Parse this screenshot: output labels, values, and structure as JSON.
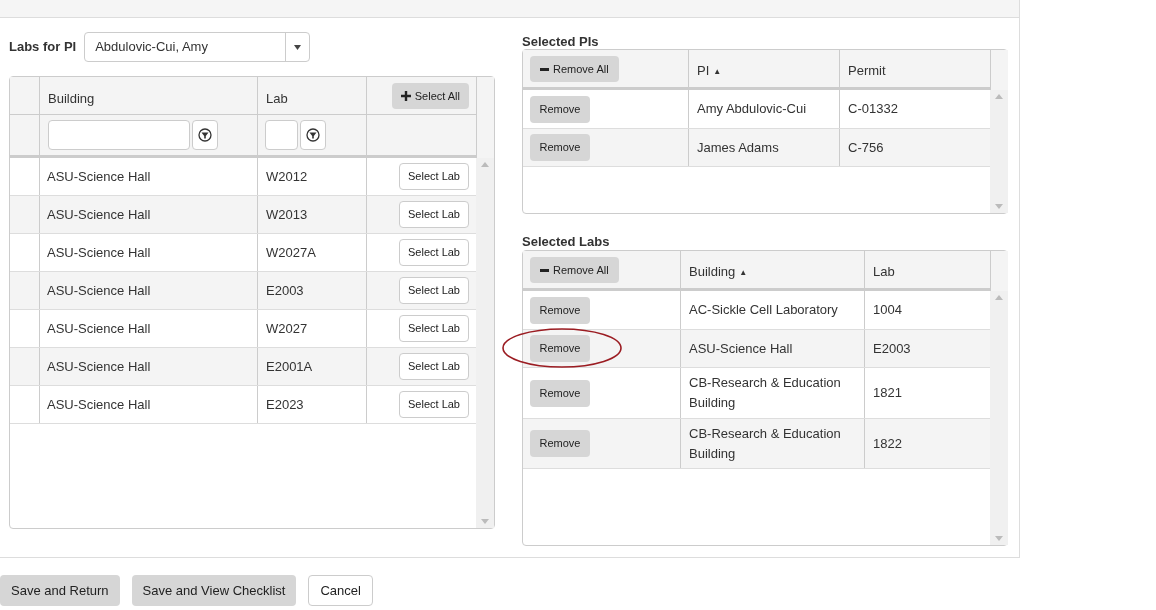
{
  "labs_for_pi": {
    "label": "Labs for PI",
    "value": "Abdulovic-Cui, Amy"
  },
  "labs_grid": {
    "columns": [
      {
        "label": "Building"
      },
      {
        "label": "Lab"
      }
    ],
    "select_all": "Select All",
    "rows": [
      {
        "building": "ASU-Science Hall",
        "lab": "W2012",
        "action": "Select Lab"
      },
      {
        "building": "ASU-Science Hall",
        "lab": "W2013",
        "action": "Select Lab"
      },
      {
        "building": "ASU-Science Hall",
        "lab": "W2027A",
        "action": "Select Lab"
      },
      {
        "building": "ASU-Science Hall",
        "lab": "E2003",
        "action": "Select Lab"
      },
      {
        "building": "ASU-Science Hall",
        "lab": "W2027",
        "action": "Select Lab"
      },
      {
        "building": "ASU-Science Hall",
        "lab": "E2001A",
        "action": "Select Lab"
      },
      {
        "building": "ASU-Science Hall",
        "lab": "E2023",
        "action": "Select Lab"
      }
    ]
  },
  "selected_pis": {
    "title": "Selected PIs",
    "remove_all": "Remove All",
    "columns": [
      {
        "label": "PI",
        "sort_mark": "▲"
      },
      {
        "label": "Permit"
      }
    ],
    "rows": [
      {
        "action": "Remove",
        "pi": "Amy Abdulovic-Cui",
        "permit": "C-01332"
      },
      {
        "action": "Remove",
        "pi": "James Adams",
        "permit": "C-756"
      }
    ]
  },
  "selected_labs": {
    "title": "Selected Labs",
    "remove_all": "Remove All",
    "columns": [
      {
        "label": "Building",
        "sort_mark": "▲"
      },
      {
        "label": "Lab"
      }
    ],
    "rows": [
      {
        "action": "Remove",
        "building": "AC-Sickle Cell Laboratory",
        "lab": "1004",
        "highlighted": false
      },
      {
        "action": "Remove",
        "building": "ASU-Science Hall",
        "lab": "E2003",
        "highlighted": true
      },
      {
        "action": "Remove",
        "building": "CB-Research & Education Building",
        "lab": "1821",
        "highlighted": false
      },
      {
        "action": "Remove",
        "building": "CB-Research & Education Building",
        "lab": "1822",
        "highlighted": false
      }
    ]
  },
  "footer_buttons": [
    {
      "label": "Save and Return",
      "kind": "primary"
    },
    {
      "label": "Save and View Checklist",
      "kind": "primary"
    },
    {
      "label": "Cancel",
      "kind": "secondary"
    }
  ]
}
